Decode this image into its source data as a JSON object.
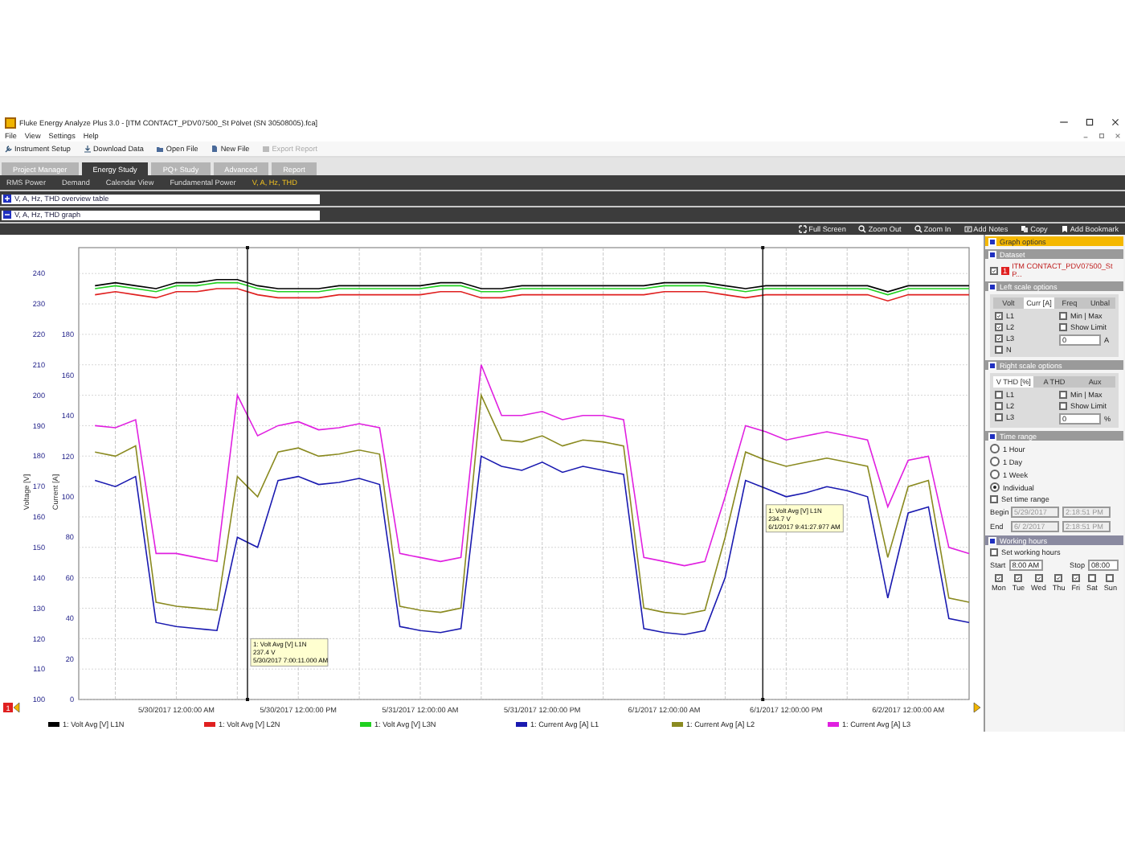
{
  "window": {
    "title": "Fluke Energy Analyze Plus 3.0 - [ITM CONTACT_PDV07500_St Pölvet (SN 30508005).fca]"
  },
  "menu": [
    "File",
    "View",
    "Settings",
    "Help"
  ],
  "toolbar": [
    {
      "label": "Instrument Setup",
      "disabled": false
    },
    {
      "label": "Download Data",
      "disabled": false
    },
    {
      "label": "Open File",
      "disabled": false
    },
    {
      "label": "New File",
      "disabled": false
    },
    {
      "label": "Export Report",
      "disabled": true
    }
  ],
  "tabs": [
    {
      "label": "Project Manager",
      "selected": false
    },
    {
      "label": "Energy Study",
      "selected": true
    },
    {
      "label": "PQ+ Study",
      "selected": false
    },
    {
      "label": "Advanced",
      "selected": false
    },
    {
      "label": "Report",
      "selected": false
    }
  ],
  "subtabs": [
    {
      "label": "RMS Power",
      "selected": false
    },
    {
      "label": "Demand",
      "selected": false
    },
    {
      "label": "Calendar View",
      "selected": false
    },
    {
      "label": "Fundamental Power",
      "selected": false
    },
    {
      "label": "V, A, Hz, THD",
      "selected": true
    }
  ],
  "sections": [
    {
      "title": "V, A, Hz, THD overview table",
      "expanded": false
    },
    {
      "title": "V, A, Hz, THD graph",
      "expanded": true
    }
  ],
  "graph_toolbar": [
    "Full Screen",
    "Zoom Out",
    "Zoom In",
    "Add Notes",
    "Copy",
    "Add Bookmark"
  ],
  "graph": {
    "dataset_badge": "1",
    "chart_data": {
      "type": "line",
      "ylabel": "Voltage [V]",
      "y2label": "Current [A]",
      "grid": true,
      "ylim": [
        100,
        248.5
      ],
      "y2lim": [
        0,
        222.8
      ],
      "categories": [
        null,
        null,
        null,
        null,
        "5/30/2017 12:00:00 AM",
        null,
        null,
        null,
        null,
        null,
        "5/30/2017 12:00:00 PM",
        null,
        null,
        null,
        null,
        null,
        "5/31/2017 12:00:00 AM",
        null,
        null,
        null,
        null,
        null,
        "5/31/2017 12:00:00 PM",
        null,
        null,
        null,
        null,
        null,
        "6/1/2017 12:00:00 AM",
        null,
        null,
        null,
        null,
        null,
        "6/1/2017 12:00:00 PM",
        null,
        null,
        null,
        null,
        null,
        "6/2/2017 12:00:00 AM",
        null,
        null,
        null
      ],
      "yticks": [
        100,
        110,
        120,
        130,
        140,
        150,
        160,
        170,
        180,
        190,
        200,
        210,
        220,
        230,
        240
      ],
      "y2ticks": [
        0,
        20,
        40,
        60,
        80,
        100,
        120,
        140,
        160,
        180
      ],
      "series": [
        {
          "name": "1: Volt Avg [V] L1N",
          "color": "#000000",
          "axis": "y",
          "values": [
            236,
            237,
            236,
            235,
            237,
            237,
            238,
            238,
            236,
            235,
            235,
            235,
            236,
            236,
            236,
            236,
            236,
            237,
            237,
            235,
            235,
            236,
            236,
            236,
            236,
            236,
            236,
            236,
            237,
            237,
            237,
            236,
            235,
            236,
            236,
            236,
            236,
            236,
            236,
            234,
            236,
            236,
            236,
            236
          ]
        },
        {
          "name": "1: Volt Avg [V] L2N",
          "color": "#e02020",
          "axis": "y",
          "values": [
            233,
            234,
            233,
            232,
            234,
            234,
            235,
            235,
            233,
            232,
            232,
            232,
            233,
            233,
            233,
            233,
            233,
            234,
            234,
            232,
            232,
            233,
            233,
            233,
            233,
            233,
            233,
            233,
            234,
            234,
            234,
            233,
            232,
            233,
            233,
            233,
            233,
            233,
            233,
            231,
            233,
            233,
            233,
            233
          ]
        },
        {
          "name": "1: Volt Avg [V] L3N",
          "color": "#20d020",
          "axis": "y",
          "values": [
            235,
            236,
            235,
            234,
            236,
            236,
            237,
            237,
            235,
            234,
            234,
            234,
            235,
            235,
            235,
            235,
            235,
            236,
            236,
            234,
            234,
            235,
            235,
            235,
            235,
            235,
            235,
            235,
            236,
            236,
            236,
            235,
            234,
            235,
            235,
            235,
            235,
            235,
            235,
            233,
            235,
            235,
            235,
            235
          ]
        },
        {
          "name": "1: Current Avg [A] L1",
          "color": "#1a1ab0",
          "axis": "y2",
          "values": [
            108,
            105,
            110,
            38,
            36,
            35,
            34,
            80,
            75,
            108,
            110,
            106,
            107,
            109,
            106,
            36,
            34,
            33,
            35,
            120,
            115,
            113,
            117,
            112,
            115,
            113,
            111,
            35,
            33,
            32,
            34,
            60,
            108,
            104,
            100,
            102,
            105,
            103,
            100,
            50,
            92,
            95,
            40,
            38
          ]
        },
        {
          "name": "1: Current Avg [A] L2",
          "color": "#8a8a20",
          "axis": "y2",
          "values": [
            122,
            120,
            125,
            48,
            46,
            45,
            44,
            110,
            100,
            122,
            124,
            120,
            121,
            123,
            121,
            46,
            44,
            43,
            45,
            150,
            128,
            127,
            130,
            125,
            128,
            127,
            125,
            45,
            43,
            42,
            44,
            80,
            122,
            118,
            115,
            117,
            119,
            117,
            115,
            70,
            105,
            108,
            50,
            48
          ]
        },
        {
          "name": "1: Current Avg [A] L3",
          "color": "#e020e0",
          "axis": "y2",
          "values": [
            135,
            134,
            138,
            72,
            72,
            70,
            68,
            150,
            130,
            135,
            137,
            133,
            134,
            136,
            134,
            72,
            70,
            68,
            70,
            165,
            140,
            140,
            142,
            138,
            140,
            140,
            138,
            70,
            68,
            66,
            68,
            100,
            135,
            132,
            128,
            130,
            132,
            130,
            128,
            95,
            118,
            120,
            75,
            72
          ]
        }
      ],
      "legend": true
    },
    "cursors": [
      {
        "lines": [
          "1: Volt Avg [V] L1N",
          "237.4 V",
          "5/30/2017 7:00:11.000 AM"
        ]
      },
      {
        "lines": [
          "1: Volt Avg [V] L1N",
          "234.7 V",
          "6/1/2017 9:41:27.977 AM"
        ]
      }
    ]
  },
  "panel": {
    "title": "Graph options",
    "dataset": {
      "header": "Dataset",
      "items": [
        {
          "label": "ITM CONTACT_PDV07500_St P...",
          "badge": "1",
          "checked": true
        }
      ]
    },
    "left_scale": {
      "header": "Left scale options",
      "tabs": [
        {
          "label": "Volt",
          "selected": false
        },
        {
          "label": "Curr [A]",
          "selected": true
        },
        {
          "label": "Freq",
          "selected": false
        },
        {
          "label": "Unbal",
          "selected": false
        }
      ],
      "phases": [
        {
          "label": "L1",
          "checked": true
        },
        {
          "label": "L2",
          "checked": true
        },
        {
          "label": "L3",
          "checked": true
        },
        {
          "label": "N",
          "checked": false
        }
      ],
      "options": [
        {
          "label": "Min | Max",
          "checked": false
        },
        {
          "label": "Show Limit",
          "checked": false
        }
      ],
      "limit": "0",
      "unit": "A"
    },
    "right_scale": {
      "header": "Right scale options",
      "tabs": [
        {
          "label": "V THD [%]",
          "selected": true
        },
        {
          "label": "A THD",
          "selected": false
        },
        {
          "label": "Aux",
          "selected": false
        }
      ],
      "phases": [
        {
          "label": "L1",
          "checked": false
        },
        {
          "label": "L2",
          "checked": false
        },
        {
          "label": "L3",
          "checked": false
        }
      ],
      "options": [
        {
          "label": "Min | Max",
          "checked": false
        },
        {
          "label": "Show Limit",
          "checked": false
        }
      ],
      "limit": "0",
      "unit": "%"
    },
    "time_range": {
      "header": "Time range",
      "options": [
        {
          "label": "1 Hour",
          "selected": false
        },
        {
          "label": "1 Day",
          "selected": false
        },
        {
          "label": "1 Week",
          "selected": false
        },
        {
          "label": "Individual",
          "selected": true
        }
      ],
      "set_range": {
        "label": "Set time range",
        "checked": false
      },
      "rows": [
        {
          "label": "Begin",
          "date": "5/29/2017",
          "time": "2:18:51 PM"
        },
        {
          "label": "End",
          "date": "6/ 2/2017",
          "time": "2:18:51 PM"
        }
      ]
    },
    "working_hours": {
      "header": "Working hours",
      "set": {
        "label": "Set working hours",
        "checked": false
      },
      "start_label": "Start",
      "start": "8:00 AM",
      "stop_label": "Stop",
      "stop": "08:00",
      "days": [
        {
          "label": "Mon",
          "checked": true
        },
        {
          "label": "Tue",
          "checked": true
        },
        {
          "label": "Wed",
          "checked": true
        },
        {
          "label": "Thu",
          "checked": true
        },
        {
          "label": "Fri",
          "checked": true
        },
        {
          "label": "Sat",
          "checked": false
        },
        {
          "label": "Sun",
          "checked": false
        }
      ]
    }
  }
}
